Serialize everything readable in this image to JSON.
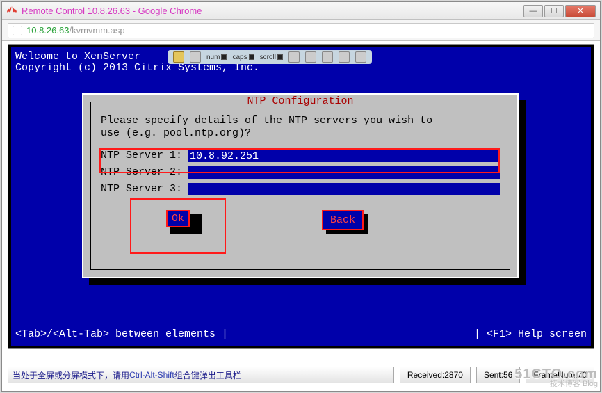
{
  "window": {
    "title": "Remote Control 10.8.26.63 - Google Chrome",
    "min": "—",
    "max": "☐",
    "close": "✕"
  },
  "address": {
    "host": "10.8.26.63",
    "path": "/kvmvmm.asp"
  },
  "console": {
    "welcome_line1": "Welcome to XenServer",
    "welcome_line2": "Copyright (c) 2013 Citrix Systems, Inc."
  },
  "kvm_toolbar": {
    "num": "num",
    "caps": "caps",
    "scroll": "scroll"
  },
  "dialog": {
    "title": "NTP Configuration",
    "prompt": "Please specify details of the NTP servers you wish to\nuse (e.g. pool.ntp.org)?",
    "fields": [
      {
        "label": "NTP Server 1: ",
        "value": "10.8.92.251"
      },
      {
        "label": "NTP Server 2: ",
        "value": ""
      },
      {
        "label": "NTP Server 3: ",
        "value": ""
      }
    ],
    "ok": "Ok",
    "back": "Back"
  },
  "help": {
    "left": "<Tab>/<Alt-Tab> between elements   |",
    "right": "|   <F1> Help screen"
  },
  "status": {
    "hint_prefix": "当处于全屏或分屏模式下，请用",
    "hint_key": "Ctrl-Alt-Shift",
    "hint_suffix": "组合键弹出工具栏",
    "received": "Received:2870",
    "sent": "Sent:56",
    "framenum": "FrameNum:70"
  },
  "watermark": {
    "line1": "51CTO.com",
    "line2": "技术博客   Blog"
  }
}
